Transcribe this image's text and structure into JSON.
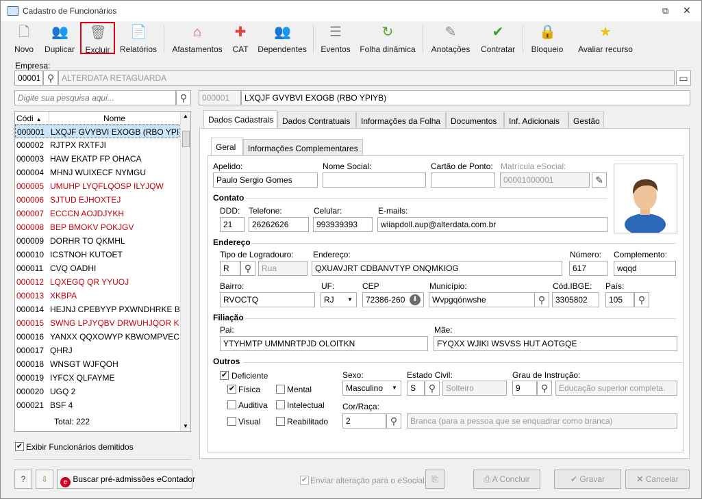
{
  "window": {
    "title": "Cadastro de Funcionários"
  },
  "toolbar": {
    "novo": "Novo",
    "duplicar": "Duplicar",
    "excluir": "Excluir",
    "relatorios": "Relatórios",
    "afastamentos": "Afastamentos",
    "cat": "CAT",
    "dependentes": "Dependentes",
    "eventos": "Eventos",
    "folha": "Folha dinâmica",
    "anotacoes": "Anotações",
    "contratar": "Contratar",
    "bloqueio": "Bloqueio",
    "avaliar": "Avaliar recurso"
  },
  "empresa": {
    "label": "Empresa:",
    "code": "00001",
    "name": "ALTERDATA RETAGUARDA"
  },
  "search": {
    "placeholder": "Digite sua pesquisa aqui..."
  },
  "current": {
    "code": "000001",
    "name": "LXQJF GVYBVI EXOGB (RBO YPIYB)"
  },
  "list": {
    "col_code": "Códi",
    "col_name": "Nome",
    "total": "Total: 222",
    "rows": [
      {
        "code": "000001",
        "name": "LXQJF GVYBVI EXOGB (RBO YPIYB)"
      },
      {
        "code": "000002",
        "name": "RJTPX RXTFJI"
      },
      {
        "code": "000003",
        "name": "HAW EKATP FP OHACA"
      },
      {
        "code": "000004",
        "name": "MHNJ WUIXECF NYMGU"
      },
      {
        "code": "000005",
        "name": "UMUHP LYQFLQOSP ILYJQW"
      },
      {
        "code": "000006",
        "name": "SJTUD EJHOXTEJ"
      },
      {
        "code": "000007",
        "name": "ECCCN  AOJDJYKH"
      },
      {
        "code": "000008",
        "name": "BEP BMOKV POKJGV"
      },
      {
        "code": "000009",
        "name": "DORHR TO QKMHL"
      },
      {
        "code": "000010",
        "name": "ICSTNOH KUTOET"
      },
      {
        "code": "000011",
        "name": "CVQ OADHI"
      },
      {
        "code": "000012",
        "name": "LQXEGQ QR YYUOJ"
      },
      {
        "code": "000013",
        "name": "XKBPA"
      },
      {
        "code": "000014",
        "name": "HEJNJ CPEBYYP PXWNDHRKE BTB J"
      },
      {
        "code": "000015",
        "name": "SWNG LPJYQBV DRWUHJQOR KQI Y"
      },
      {
        "code": "000016",
        "name": "YANXX QQXOWYP KBWOMPVEC A"
      },
      {
        "code": "000017",
        "name": "QHRJ"
      },
      {
        "code": "000018",
        "name": "WNSGT WJFQOH"
      },
      {
        "code": "000019",
        "name": "IYFCX QLFAYME"
      },
      {
        "code": "000020",
        "name": "UGQ 2"
      },
      {
        "code": "000021",
        "name": "BSF 4"
      }
    ]
  },
  "exibir_demitidos": "Exibir Funcionários demitidos",
  "tabs": [
    "Dados Cadastrais",
    "Dados Contratuais",
    "Informações da Folha",
    "Documentos",
    "Inf. Adicionais",
    "Gestão"
  ],
  "subtabs": [
    "Geral",
    "Informações Complementares"
  ],
  "form": {
    "apelido_label": "Apelido:",
    "apelido": "Paulo Sergio Gomes",
    "nome_social_label": "Nome Social:",
    "nome_social": "",
    "cartao_label": "Cartão de Ponto:",
    "cartao": "",
    "matricula_label": "Matrícula eSocial:",
    "matricula": "00001000001",
    "contato": "Contato",
    "ddd_label": "DDD:",
    "ddd": "21",
    "telefone_label": "Telefone:",
    "telefone": "26262626",
    "celular_label": "Celular:",
    "celular": "993939393",
    "emails_label": "E-mails:",
    "emails": "wiiapdoll.aup@alterdata.com.br",
    "endereco_sec": "Endereço",
    "tipo_label": "Tipo de Logradouro:",
    "tipo": "R",
    "tipo_desc": "Rua",
    "endereco_label": "Endereço:",
    "endereco": "QXUAVJRT CDBANVTYP ONQMKIOG",
    "numero_label": "Número:",
    "numero": "617",
    "complemento_label": "Complemento:",
    "complemento": "wqqd",
    "bairro_label": "Bairro:",
    "bairro": "RVOCTQ",
    "uf_label": "UF:",
    "uf": "RJ",
    "cep_label": "CEP",
    "cep": "72386-260",
    "municipio_label": "Município:",
    "municipio": "Wvpgqónwshe",
    "ibge_label": "Cód.IBGE:",
    "ibge": "3305802",
    "pais_label": "País:",
    "pais": "105",
    "filiacao": "Filiação",
    "pai_label": "Pai:",
    "pai": "YTYHMTP UMMNRTPJD OLOITKN",
    "mae_label": "Mãe:",
    "mae": "FYQXX WJIKI WSVSS HUT AOTGQE",
    "outros": "Outros",
    "deficiente": "Deficiente",
    "fisica": "Física",
    "mental": "Mental",
    "auditiva": "Auditiva",
    "intelectual": "Intelectual",
    "visual": "Visual",
    "reabilitado": "Reabilitado",
    "sexo_label": "Sexo:",
    "sexo": "Masculino",
    "civil_label": "Estado Civil:",
    "civil": "S",
    "civil_desc": "Solteiro",
    "grau_label": "Grau de Instrução:",
    "grau": "9",
    "grau_desc": "Educação superior completa.",
    "cor_label": "Cor/Raça:",
    "cor": "2",
    "cor_desc": "Branca (para a pessoa que se enquadrar como branca)"
  },
  "footer": {
    "buscar": "Buscar pré-admissões eContador",
    "enviar": "Enviar alteração para o eSocial",
    "concluir": "A Concluir",
    "gravar": "Gravar",
    "cancelar": "Cancelar"
  }
}
